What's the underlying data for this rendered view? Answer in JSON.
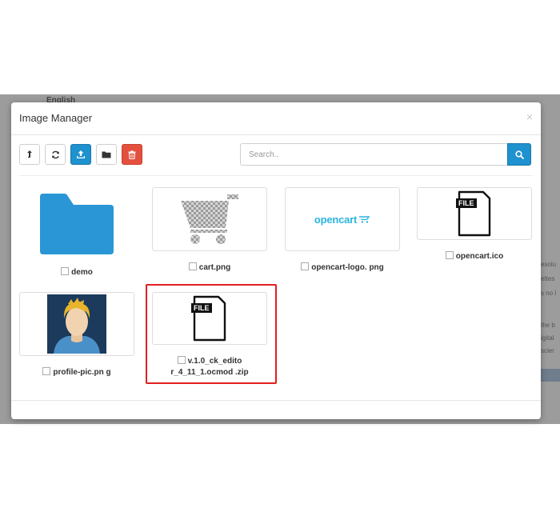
{
  "background": {
    "language": "English",
    "snippets": [
      "esolu",
      "ettes",
      "s no l",
      "the b",
      "igital",
      "scier"
    ]
  },
  "modal": {
    "title": "Image Manager",
    "close_icon": "×"
  },
  "toolbar": {
    "buttons": [
      {
        "name": "parent-directory-button",
        "icon": "level-up-icon"
      },
      {
        "name": "refresh-button",
        "icon": "refresh-icon"
      },
      {
        "name": "upload-button",
        "icon": "upload-icon"
      },
      {
        "name": "new-folder-button",
        "icon": "folder-icon"
      },
      {
        "name": "delete-button",
        "icon": "trash-icon"
      }
    ]
  },
  "search": {
    "placeholder": "Search..",
    "value": ""
  },
  "items": [
    {
      "label": "demo",
      "type": "folder"
    },
    {
      "label": "cart.png",
      "type": "image"
    },
    {
      "label": "opencart-logo. png",
      "type": "image",
      "logo_text": "opencart"
    },
    {
      "label": "opencart.ico",
      "type": "file",
      "badge": "FILE"
    },
    {
      "label": "profile-pic.pn g",
      "type": "image"
    },
    {
      "label_line1": "v.1.0_ck_edito",
      "label_line2": "r_4_11_1.ocmod .zip",
      "type": "file",
      "badge": "FILE",
      "selected_highlight": true
    }
  ],
  "colors": {
    "primary": "#1e91cf",
    "danger": "#e3503e",
    "highlight": "#e02020",
    "folder": "#2a96d6"
  }
}
